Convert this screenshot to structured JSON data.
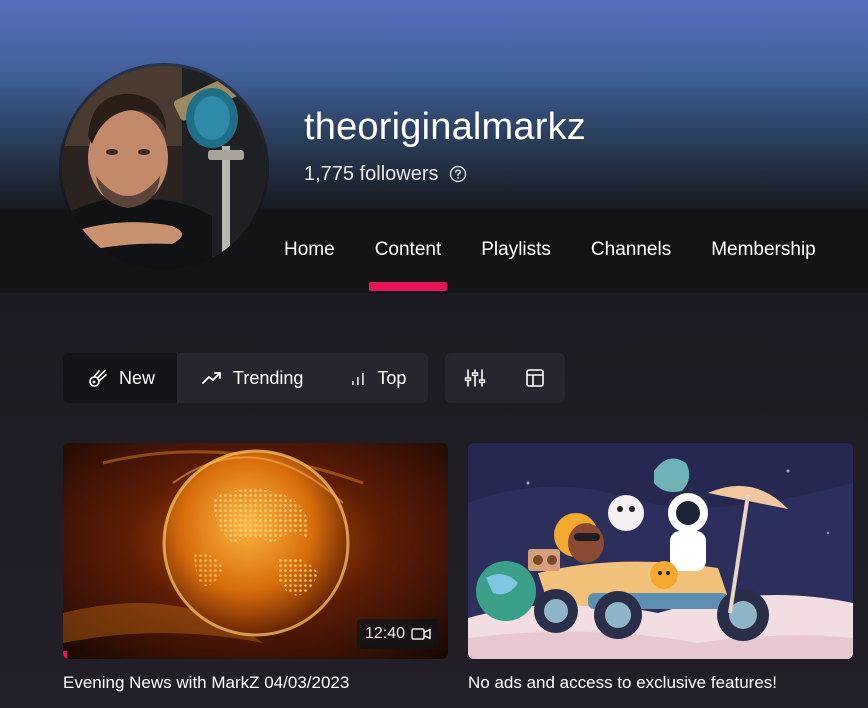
{
  "channel": {
    "name": "theoriginalmarkz",
    "followers": "1,775 followers"
  },
  "tabs": [
    {
      "label": "Home"
    },
    {
      "label": "Content"
    },
    {
      "label": "Playlists"
    },
    {
      "label": "Channels"
    },
    {
      "label": "Membership"
    }
  ],
  "active_tab": "Content",
  "sort_filters": [
    {
      "label": "New",
      "icon": "comet-icon"
    },
    {
      "label": "Trending",
      "icon": "trending-up-icon"
    },
    {
      "label": "Top",
      "icon": "signal-bars-icon"
    }
  ],
  "active_filter": "New",
  "tool_icons": [
    "sliders-icon",
    "layout-icon"
  ],
  "videos": [
    {
      "title": "Evening News with MarkZ 04/03/2023",
      "duration": "12:40",
      "thumbnail_icon": "globe-thumbnail"
    },
    {
      "title": "No ads and access to exclusive features!",
      "thumbnail_icon": "membership-illustration"
    }
  ],
  "colors": {
    "accent": "#e61458",
    "header_top": "#5a6fbe",
    "tabbar": "#141416",
    "page_bg": "#1f1c24",
    "chip_bg": "#27252d"
  }
}
